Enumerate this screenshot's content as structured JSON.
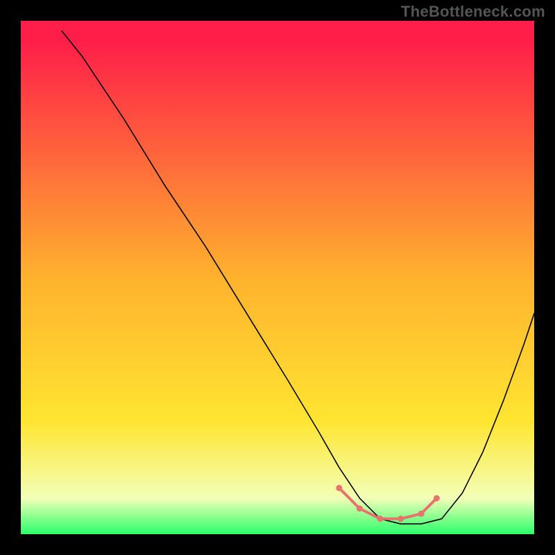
{
  "watermark": "TheBottleneck.com",
  "chart_data": {
    "type": "line",
    "title": "",
    "xlabel": "",
    "ylabel": "",
    "xlim": [
      0,
      100
    ],
    "ylim": [
      0,
      100
    ],
    "grid": false,
    "legend": false,
    "background_gradient": {
      "top_color": "#ff1e49",
      "mid_color": "#ffe531",
      "bottom_color": "#2aff6b"
    },
    "series": [
      {
        "name": "bottleneck-curve",
        "color": "#000000",
        "width": 1.6,
        "x": [
          8,
          12,
          20,
          28,
          36,
          44,
          52,
          58,
          62,
          66,
          70,
          74,
          78,
          82,
          86,
          90,
          94,
          98,
          100
        ],
        "values": [
          98,
          93,
          81,
          68,
          56,
          43,
          30,
          20,
          13,
          7,
          3,
          2,
          2,
          3,
          8,
          16,
          26,
          37,
          43
        ]
      }
    ],
    "highlight_segment": {
      "name": "optimal-range",
      "color": "#e6746b",
      "width": 4,
      "dot_radius": 4.5,
      "x": [
        62,
        66,
        70,
        74,
        78,
        81
      ],
      "values": [
        9,
        5,
        3,
        3,
        4,
        7
      ]
    }
  }
}
